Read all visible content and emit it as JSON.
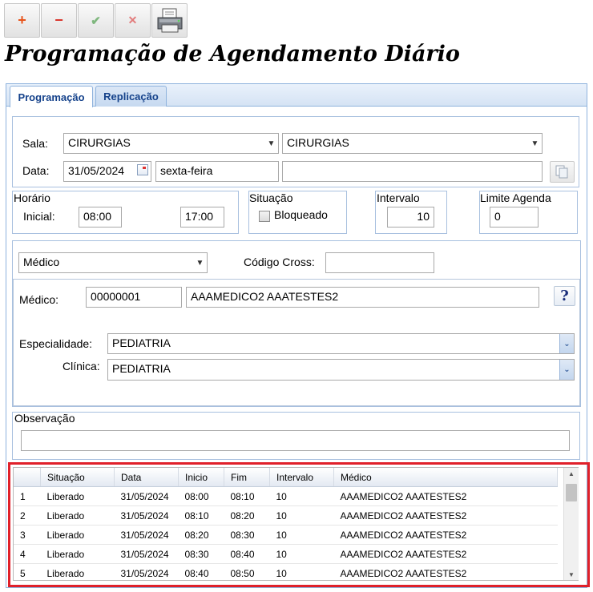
{
  "title": "Programação de Agendamento Diário",
  "toolbar": {
    "add": "+",
    "remove": "−",
    "confirm": "✔",
    "cancel": "✕"
  },
  "tabs": [
    "Programação",
    "Replicação"
  ],
  "form": {
    "sala_label": "Sala:",
    "sala_value": "CIRURGIAS",
    "sala_value2": "CIRURGIAS",
    "data_label": "Data:",
    "data_value": "31/05/2024",
    "weekday": "sexta-feira",
    "extra_value": "",
    "horario_label": "Horário",
    "inicial_label": "Inicial:",
    "inicial_value": "08:00",
    "final_value": "17:00",
    "situacao_label": "Situação",
    "bloqueado_label": "Bloqueado",
    "bloqueado_checked": false,
    "intervalo_label": "Intervalo",
    "intervalo_value": "10",
    "limite_label": "Limite Agenda",
    "limite_value": "0",
    "tipo_value": "Médico",
    "codigo_cross_label": "Código Cross:",
    "codigo_cross_value": "",
    "medico_label": "Médico:",
    "medico_code": "00000001",
    "medico_name": "AAAMEDICO2 AAATESTES2",
    "especialidade_label": "Especialidade:",
    "especialidade_value": "PEDIATRIA",
    "clinica_label": "Clínica:",
    "clinica_value": "PEDIATRIA",
    "observacao_label": "Observação",
    "observacao_value": ""
  },
  "grid": {
    "columns": [
      "",
      "Situação",
      "Data",
      "Inicio",
      "Fim",
      "Intervalo",
      "Médico"
    ],
    "rows": [
      [
        "1",
        "Liberado",
        "31/05/2024",
        "08:00",
        "08:10",
        "10",
        "AAAMEDICO2 AAATESTES2"
      ],
      [
        "2",
        "Liberado",
        "31/05/2024",
        "08:10",
        "08:20",
        "10",
        "AAAMEDICO2 AAATESTES2"
      ],
      [
        "3",
        "Liberado",
        "31/05/2024",
        "08:20",
        "08:30",
        "10",
        "AAAMEDICO2 AAATESTES2"
      ],
      [
        "4",
        "Liberado",
        "31/05/2024",
        "08:30",
        "08:40",
        "10",
        "AAAMEDICO2 AAATESTES2"
      ],
      [
        "5",
        "Liberado",
        "31/05/2024",
        "08:40",
        "08:50",
        "10",
        "AAAMEDICO2 AAATESTES2"
      ]
    ]
  },
  "colors": {
    "highlight_border": "#e0202a",
    "tab_text": "#15428b",
    "add_icon": "#e8531a",
    "remove_icon": "#d9342b",
    "confirm_icon": "#7fb77e",
    "cancel_icon": "#e27b7b"
  }
}
